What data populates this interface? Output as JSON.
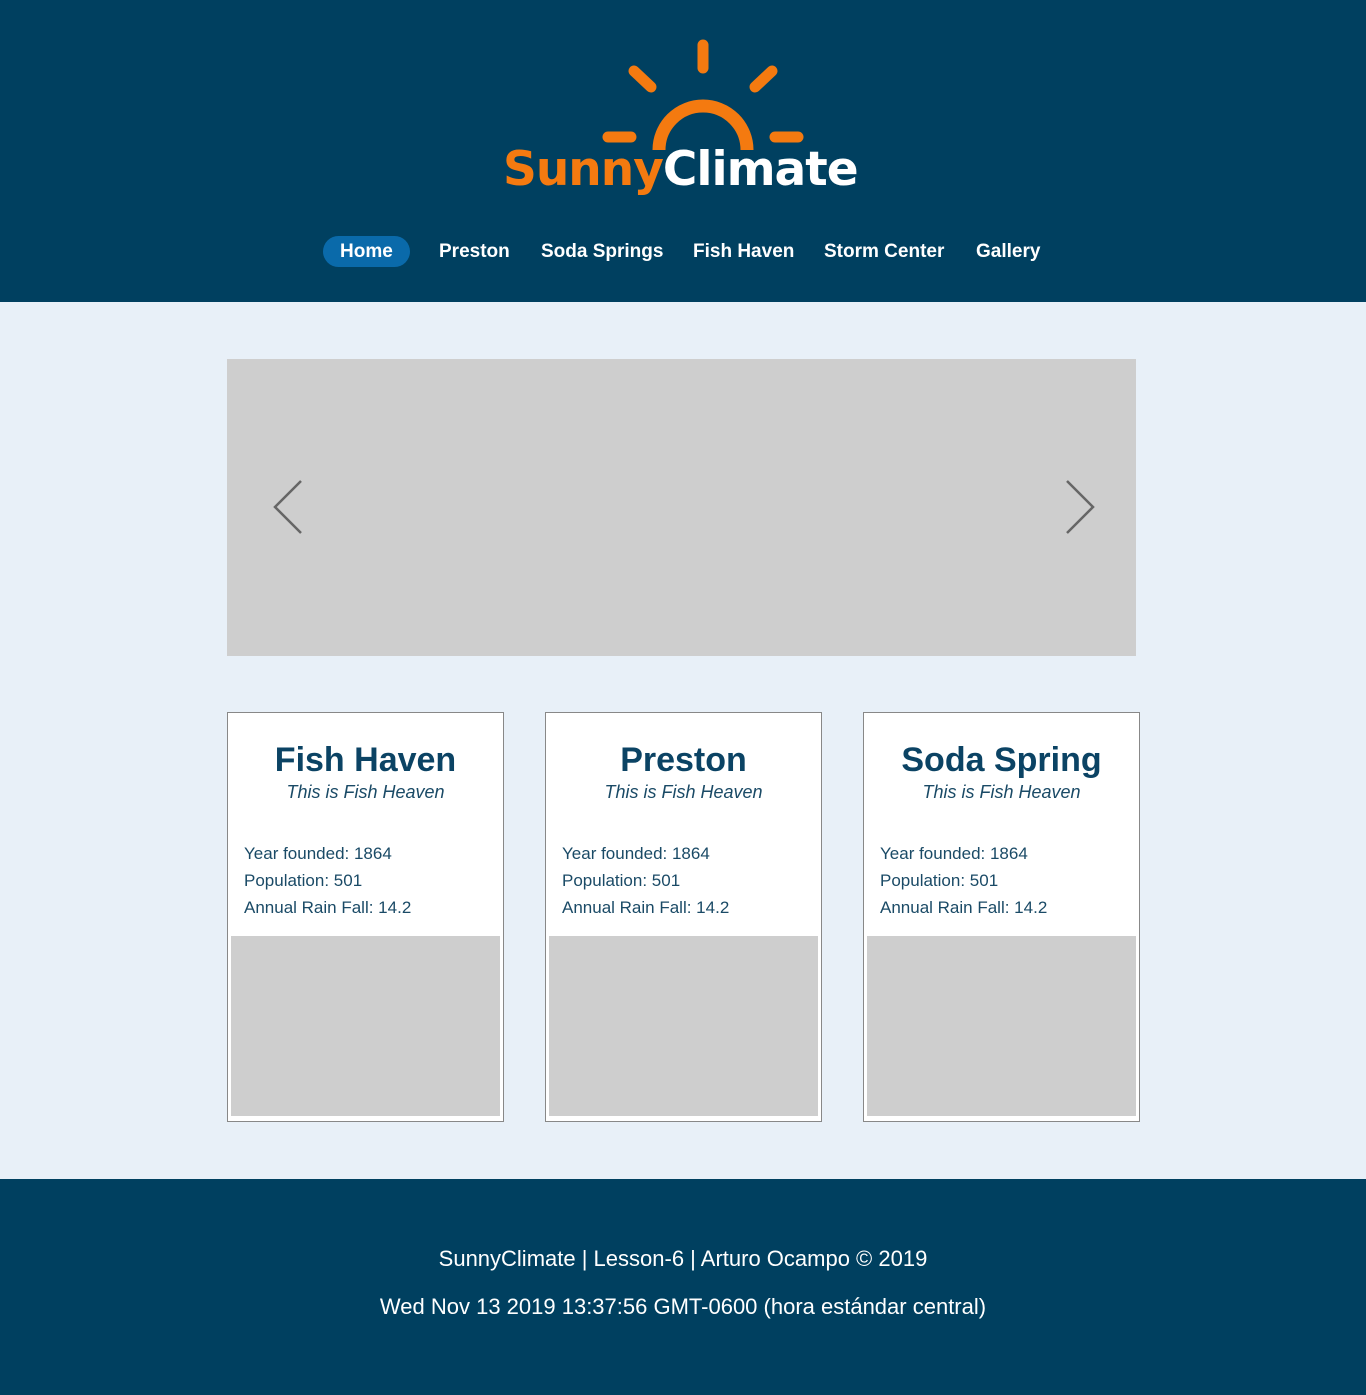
{
  "brand": {
    "part1": "Sunny",
    "part2": "Climate",
    "colors": {
      "orange": "#f47a10",
      "white": "#ffffff"
    }
  },
  "nav": {
    "items": [
      {
        "label": "Home",
        "active": true
      },
      {
        "label": "Preston",
        "active": false
      },
      {
        "label": "Soda Springs",
        "active": false
      },
      {
        "label": "Fish Haven",
        "active": false
      },
      {
        "label": "Storm Center",
        "active": false
      },
      {
        "label": "Gallery",
        "active": false
      }
    ]
  },
  "slider": {
    "prev_icon": "chevron-left-icon",
    "next_icon": "chevron-right-icon"
  },
  "towns": [
    {
      "name": "Fish Haven",
      "motto": "This is Fish Heaven",
      "year_founded": "Year founded: 1864",
      "population": "Population: 501",
      "rainfall": "Annual Rain Fall: 14.2"
    },
    {
      "name": "Preston",
      "motto": "This is Fish Heaven",
      "year_founded": "Year founded: 1864",
      "population": "Population: 501",
      "rainfall": "Annual Rain Fall: 14.2"
    },
    {
      "name": "Soda Spring",
      "motto": "This is Fish Heaven",
      "year_founded": "Year founded: 1864",
      "population": "Population: 501",
      "rainfall": "Annual Rain Fall: 14.2"
    }
  ],
  "footer": {
    "credit": "SunnyClimate | Lesson-6 | Arturo Ocampo © 2019",
    "date": "Wed Nov 13 2019 13:37:56 GMT-0600 (hora estándar central)"
  },
  "colors": {
    "header_bg": "#004060",
    "page_bg": "#e8f0f8",
    "nav_active": "#0a6aaa",
    "card_title": "#0b4364",
    "placeholder": "#cecece"
  }
}
